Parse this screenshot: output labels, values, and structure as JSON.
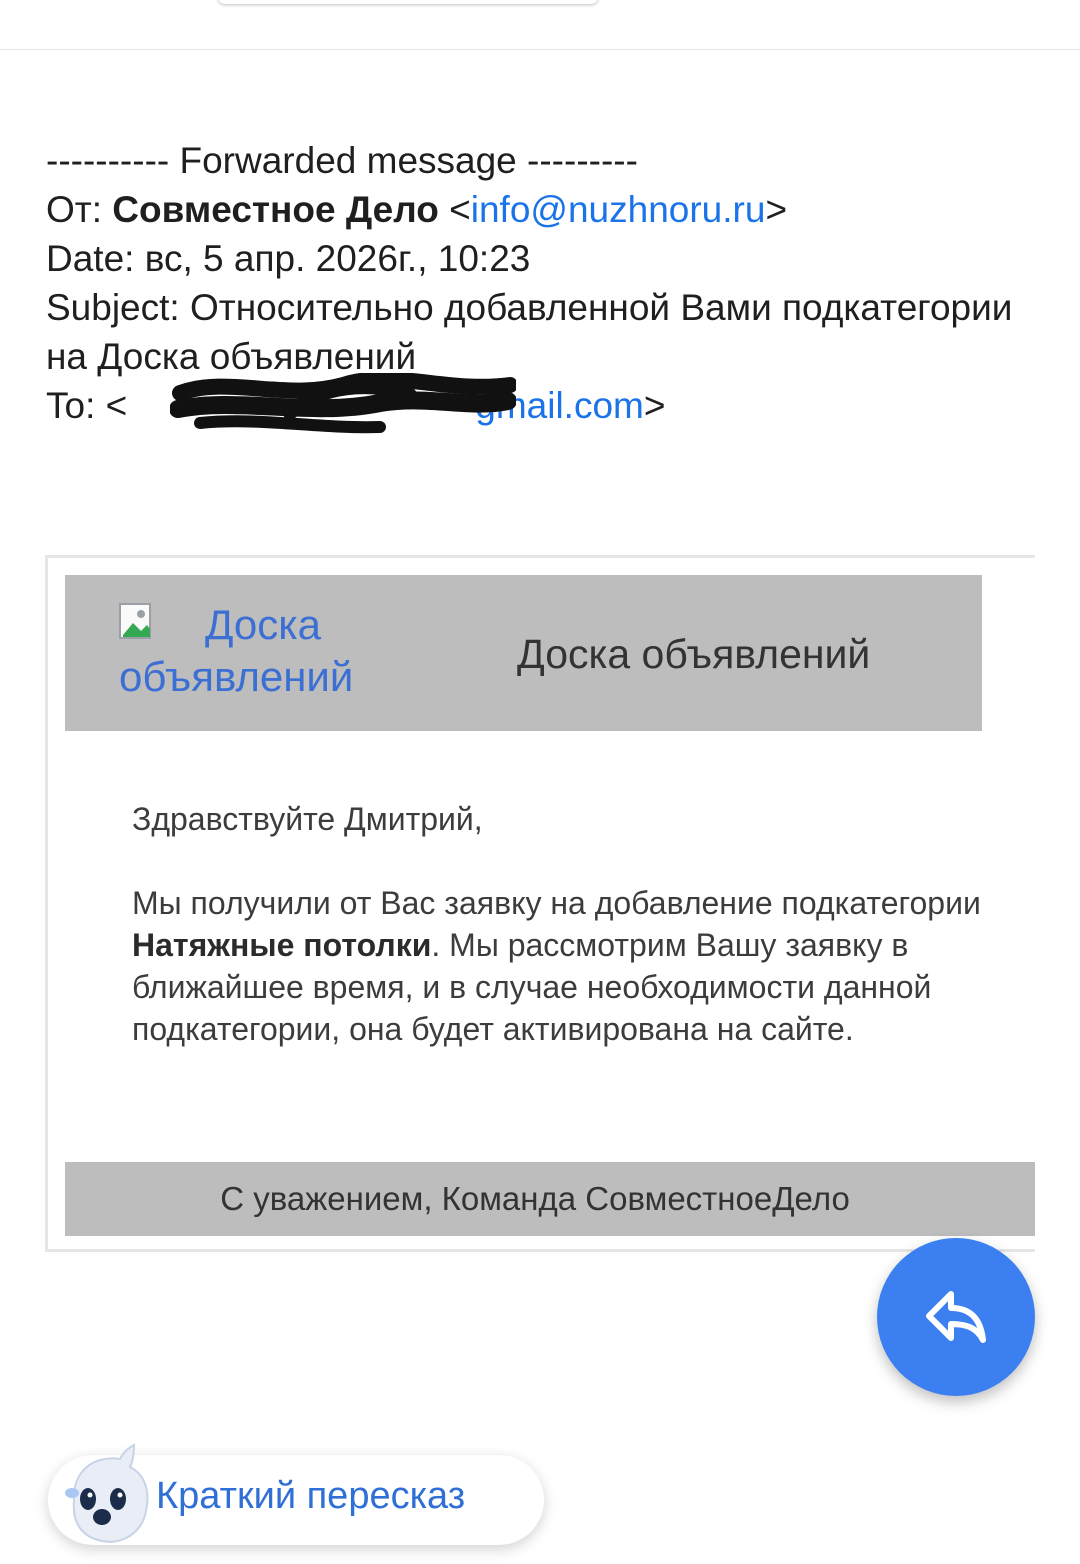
{
  "forward": {
    "header": "---------- Forwarded message ---------",
    "from_label": "От: ",
    "from_name": "Совместное Дело",
    "from_email": "info@nuzhnoru.ru",
    "date_label": "Date: ",
    "date_value": "вс, 5 апр. 2026г., 10:23",
    "subject_label": "Subject: ",
    "subject_value": "Относительно добавленной Вами подкатегории на Доска объявлений",
    "to_label": "To: ",
    "to_email_visible": "gmail.com"
  },
  "card": {
    "logo_link_text": "Доска объявлений",
    "header_title": "Доска объявлений",
    "greeting": "Здравствуйте Дмитрий,",
    "body_before": "Мы получили от Вас заявку на добавление подкатегории ",
    "body_bold": "Натяжные потолки",
    "body_after": ". Мы рассмотрим Вашу заявку в ближайшее время, и в случае необходимости данной подкатегории, она будет активирована на сайте.",
    "footer": "С уважением, Команда СовместноеДело"
  },
  "summary_chip": {
    "label": "Краткий пересказ"
  },
  "colors": {
    "link": "#1a73e8",
    "fab": "#3b7ff0",
    "band": "#bdbdbd",
    "chip_text": "#2f6fd6"
  },
  "icons": {
    "fab": "reply-icon",
    "logo": "broken-image-icon",
    "chip": "mascot-icon"
  }
}
